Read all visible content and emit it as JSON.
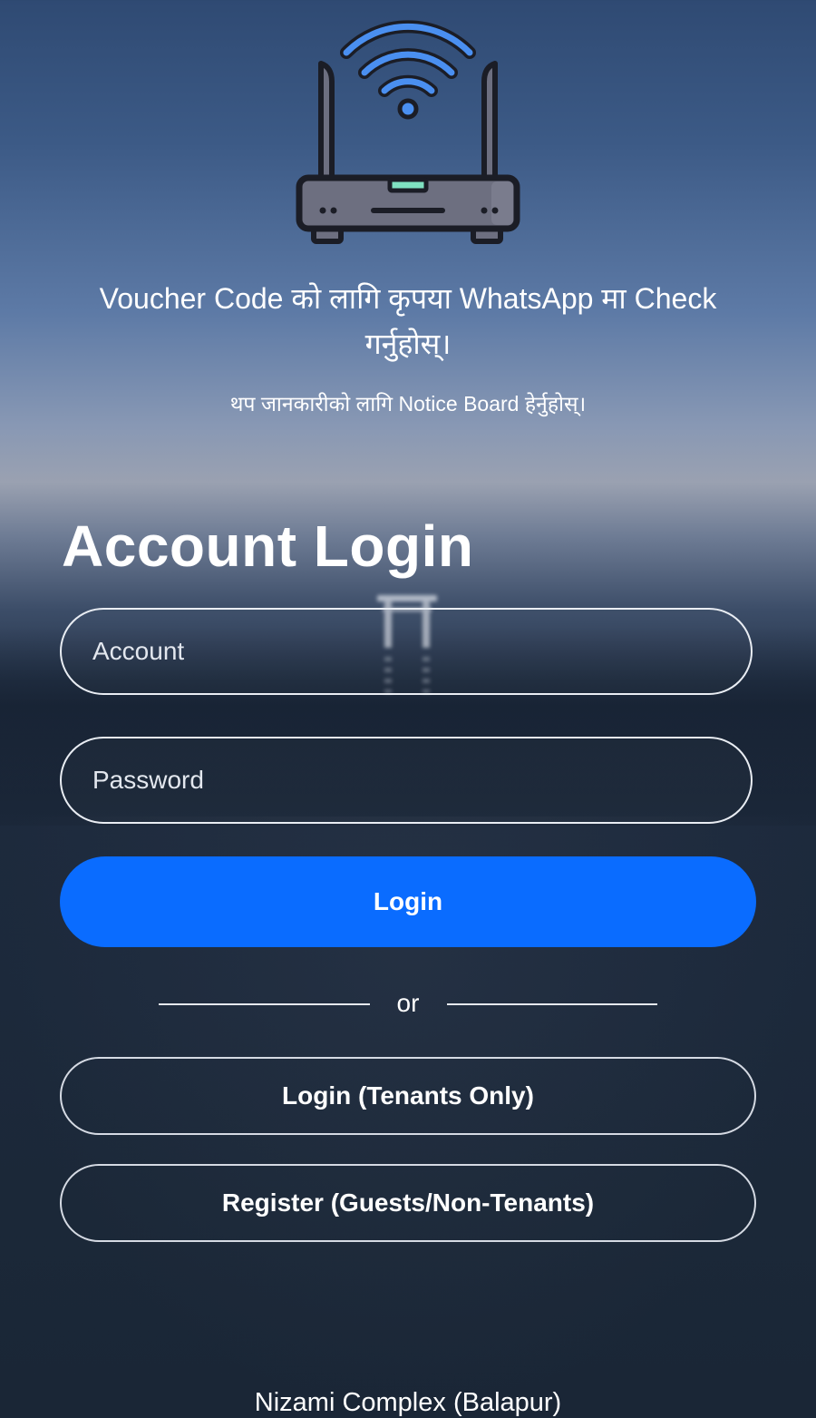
{
  "header": {
    "icon": "wifi-router-icon",
    "voucher_message": "Voucher Code को लागि कृपया WhatsApp मा Check गर्नुहोस्।",
    "notice_message": "थप जानकारीको लागि Notice Board हेर्नुहोस्।"
  },
  "form": {
    "title": "Account Login",
    "account_placeholder": "Account",
    "account_value": "",
    "password_placeholder": "Password",
    "password_value": "",
    "login_label": "Login",
    "divider_label": "or",
    "tenants_login_label": "Login (Tenants Only)",
    "register_label": "Register (Guests/Non-Tenants)"
  },
  "footer": {
    "location": "Nizami Complex (Balapur)"
  },
  "colors": {
    "primary_button": "#0a6cff",
    "wifi_signal": "#4a8ff0",
    "router_body": "#6d6f80",
    "router_led": "#7fe0c0"
  }
}
